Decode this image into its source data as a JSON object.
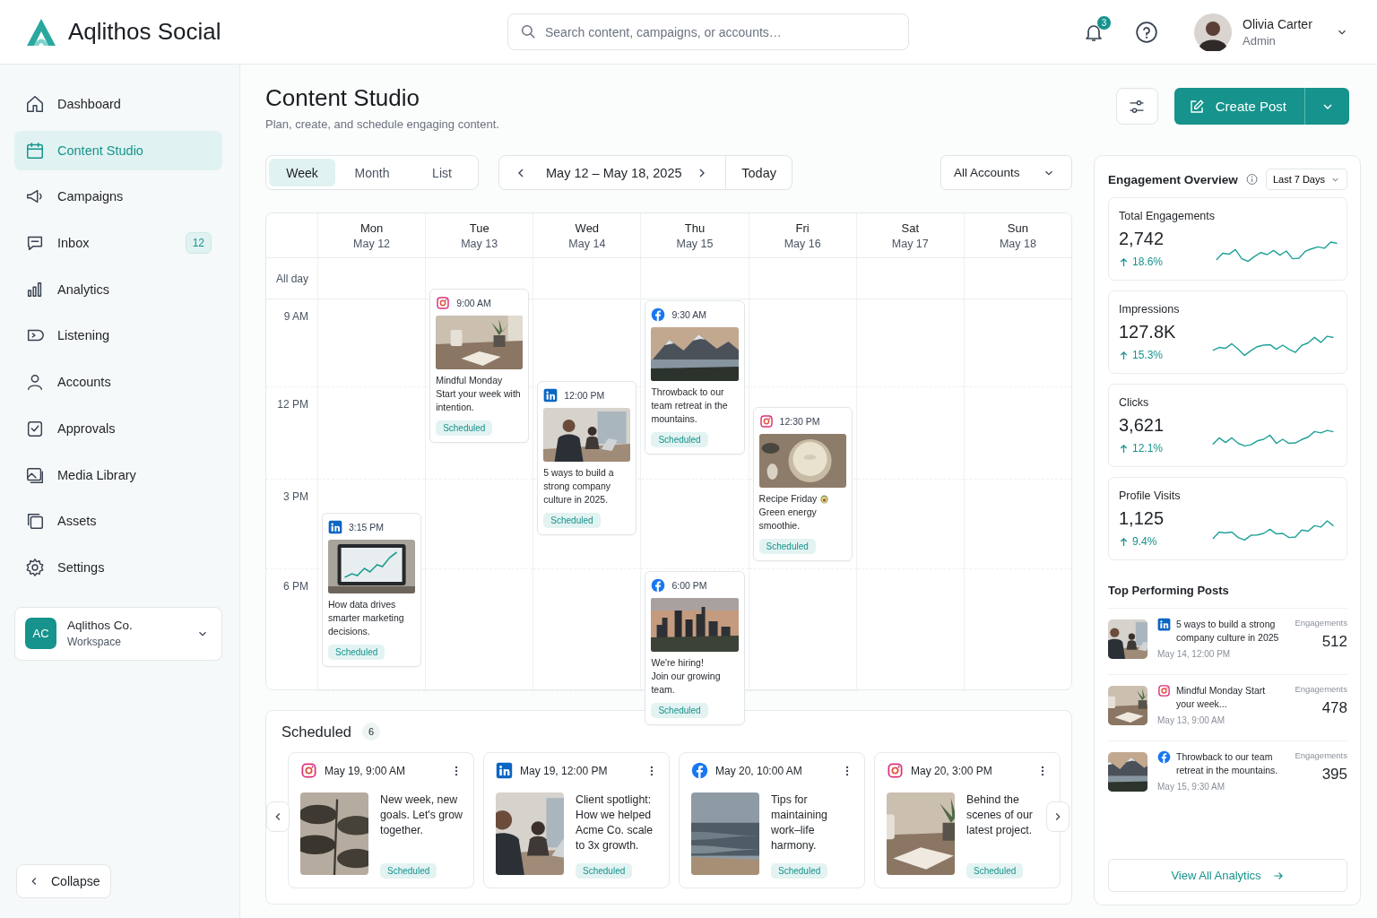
{
  "app": {
    "name": "Aqlithos Social"
  },
  "search": {
    "placeholder": "Search content, campaigns, or accounts…"
  },
  "notifications": {
    "count": "3"
  },
  "user": {
    "name": "Olivia Carter",
    "role": "Admin"
  },
  "sidebar": {
    "items": [
      {
        "label": "Dashboard",
        "selected": false
      },
      {
        "label": "Content Studio",
        "selected": true
      },
      {
        "label": "Campaigns",
        "selected": false
      },
      {
        "label": "Inbox",
        "selected": false,
        "badge": "12"
      },
      {
        "label": "Analytics",
        "selected": false
      },
      {
        "label": "Listening",
        "selected": false
      },
      {
        "label": "Accounts",
        "selected": false
      },
      {
        "label": "Approvals",
        "selected": false
      },
      {
        "label": "Media Library",
        "selected": false
      },
      {
        "label": "Assets",
        "selected": false
      },
      {
        "label": "Settings",
        "selected": false
      }
    ]
  },
  "workspace": {
    "initials": "AC",
    "name": "Aqlithos Co.",
    "subtitle": "Workspace"
  },
  "collapse_button": "Collapse",
  "page": {
    "title": "Content Studio",
    "subtitle": "Plan, create, and schedule engaging content."
  },
  "create_button": "Create Post",
  "view_tabs": [
    {
      "label": "Week",
      "selected": true
    },
    {
      "label": "Month",
      "selected": false
    },
    {
      "label": "List",
      "selected": false
    }
  ],
  "date_range": "May 12 – May 18, 2025",
  "today_button": "Today",
  "account_filter": "All Accounts",
  "calendar": {
    "all_day_label": "All day",
    "time_labels": [
      "9 AM",
      "12 PM",
      "3 PM",
      "6 PM"
    ],
    "days": [
      {
        "name": "Mon",
        "date": "May 12",
        "events": [
          {
            "kind": "linkedin",
            "time": "3:15 PM",
            "text": "How data drives smarter marketing decisions.",
            "status": "Scheduled"
          }
        ]
      },
      {
        "name": "Tue",
        "date": "May 13",
        "events": [
          {
            "kind": "instagram",
            "time": "9:00 AM",
            "headline": "Mindful Monday",
            "text": "Start your week with intention.",
            "status": "Scheduled"
          }
        ]
      },
      {
        "name": "Wed",
        "date": "May 14",
        "events": [
          {
            "kind": "linkedin",
            "time": "12:00 PM",
            "text": "5 ways to build a strong company culture in 2025.",
            "status": "Scheduled"
          }
        ]
      },
      {
        "name": "Thu",
        "date": "May 15",
        "events": [
          {
            "kind": "facebook",
            "time": "9:30 AM",
            "text": "Throwback to our team retreat in the mountains.",
            "status": "Scheduled"
          },
          {
            "kind": "facebook",
            "time": "6:00 PM",
            "headline": "We're hiring!",
            "text": "Join our growing team.",
            "status": "Scheduled"
          }
        ]
      },
      {
        "name": "Fri",
        "date": "May 16",
        "events": [
          {
            "kind": "instagram",
            "time": "12:30 PM",
            "headline": "Recipe Friday",
            "emoji": true,
            "text": "Green energy smoothie.",
            "status": "Scheduled"
          }
        ]
      },
      {
        "name": "Sat",
        "date": "May 17"
      },
      {
        "name": "Sun",
        "date": "May 18"
      }
    ]
  },
  "scheduled": {
    "title": "Scheduled",
    "count": "6",
    "posts": [
      {
        "kind": "instagram",
        "datetime": "May 19, 9:00 AM",
        "text": "New week, new goals. Let's grow together.",
        "status": "Scheduled"
      },
      {
        "kind": "linkedin",
        "datetime": "May 19, 12:00 PM",
        "text": "Client spotlight: How we helped Acme Co. scale to 3x growth.",
        "status": "Scheduled"
      },
      {
        "kind": "facebook",
        "datetime": "May 20, 10:00 AM",
        "text": "Tips for maintaining work–life harmony.",
        "status": "Scheduled"
      },
      {
        "kind": "instagram",
        "datetime": "May 20, 3:00 PM",
        "text": "Behind the scenes of our latest project.",
        "status": "Scheduled"
      }
    ]
  },
  "engagement": {
    "title": "Engagement Overview",
    "period": "Last 7 Days",
    "metrics": [
      {
        "label": "Total Engagements",
        "value": "2,742",
        "change": "18.6%"
      },
      {
        "label": "Impressions",
        "value": "127.8K",
        "change": "15.3%"
      },
      {
        "label": "Clicks",
        "value": "3,621",
        "change": "12.1%"
      },
      {
        "label": "Profile Visits",
        "value": "1,125",
        "change": "9.4%"
      }
    ]
  },
  "top_posts": {
    "title": "Top Performing Posts",
    "posts": [
      {
        "kind": "linkedin",
        "text": "5 ways to build a strong company culture in 2025",
        "date": "May 14, 12:00 PM",
        "metric_label": "Engagements",
        "value": "512"
      },
      {
        "kind": "instagram",
        "text": "Mindful Monday Start your week...",
        "date": "May 13, 9:00 AM",
        "metric_label": "Engagements",
        "value": "478"
      },
      {
        "kind": "facebook",
        "text": "Throwback to our team retreat in the mountains.",
        "date": "May 15, 9:30 AM",
        "metric_label": "Engagements",
        "value": "395"
      }
    ]
  },
  "view_all_button": "View All Analytics"
}
